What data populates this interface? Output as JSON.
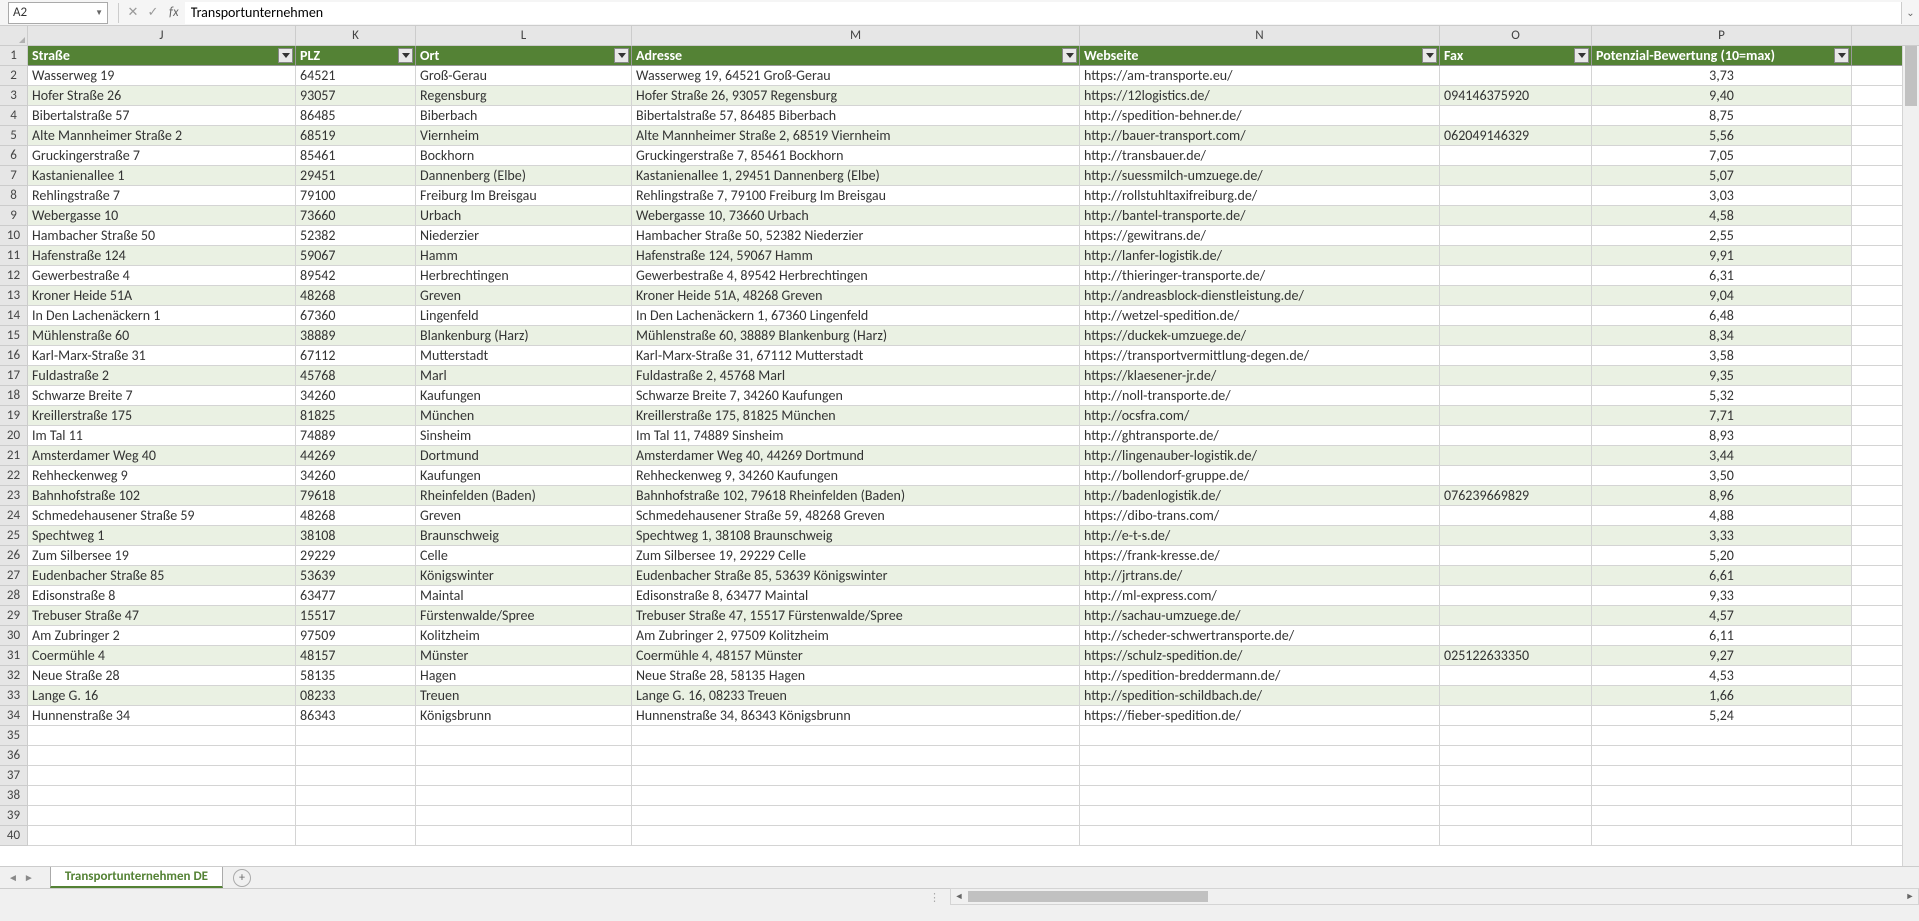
{
  "name_box": "A2",
  "formula_value": "Transportunternehmen",
  "sheet_tab": "Transportunternehmen DE",
  "columns_letters": [
    "J",
    "K",
    "L",
    "M",
    "N",
    "O",
    "P"
  ],
  "headers": {
    "J": "Straße",
    "K": "PLZ",
    "L": "Ort",
    "M": "Adresse",
    "N": "Webseite",
    "O": "Fax",
    "P": "Potenzial-Bewertung (10=max)"
  },
  "rows": [
    {
      "n": 2,
      "J": "Wasserweg 19",
      "K": "64521",
      "L": "Groß-Gerau",
      "M": "Wasserweg 19, 64521 Groß-Gerau",
      "N": "https://am-transporte.eu/",
      "O": "",
      "P": "3,73"
    },
    {
      "n": 3,
      "J": "Hofer Straße 26",
      "K": "93057",
      "L": "Regensburg",
      "M": "Hofer Straße 26, 93057 Regensburg",
      "N": "https://12logistics.de/",
      "O": "094146375920",
      "P": "9,40"
    },
    {
      "n": 4,
      "J": "Bibertalstraße 57",
      "K": "86485",
      "L": "Biberbach",
      "M": "Bibertalstraße 57, 86485 Biberbach",
      "N": "http://spedition-behner.de/",
      "O": "",
      "P": "8,75"
    },
    {
      "n": 5,
      "J": "Alte Mannheimer Straße 2",
      "K": "68519",
      "L": "Viernheim",
      "M": "Alte Mannheimer Straße 2, 68519 Viernheim",
      "N": "http://bauer-transport.com/",
      "O": "062049146329",
      "P": "5,56"
    },
    {
      "n": 6,
      "J": "Gruckingerstraße 7",
      "K": "85461",
      "L": "Bockhorn",
      "M": "Gruckingerstraße 7, 85461 Bockhorn",
      "N": "http://transbauer.de/",
      "O": "",
      "P": "7,05"
    },
    {
      "n": 7,
      "J": "Kastanienallee 1",
      "K": "29451",
      "L": "Dannenberg (Elbe)",
      "M": "Kastanienallee 1, 29451 Dannenberg (Elbe)",
      "N": "http://suessmilch-umzuege.de/",
      "O": "",
      "P": "5,07"
    },
    {
      "n": 8,
      "J": "Rehlingstraße 7",
      "K": "79100",
      "L": "Freiburg Im Breisgau",
      "M": "Rehlingstraße 7, 79100 Freiburg Im Breisgau",
      "N": "http://rollstuhltaxifreiburg.de/",
      "O": "",
      "P": "3,03"
    },
    {
      "n": 9,
      "J": "Webergasse 10",
      "K": "73660",
      "L": "Urbach",
      "M": "Webergasse 10, 73660 Urbach",
      "N": "http://bantel-transporte.de/",
      "O": "",
      "P": "4,58"
    },
    {
      "n": 10,
      "J": "Hambacher Straße 50",
      "K": "52382",
      "L": "Niederzier",
      "M": "Hambacher Straße 50, 52382 Niederzier",
      "N": "https://gewitrans.de/",
      "O": "",
      "P": "2,55"
    },
    {
      "n": 11,
      "J": "Hafenstraße 124",
      "K": "59067",
      "L": "Hamm",
      "M": "Hafenstraße 124, 59067 Hamm",
      "N": "http://lanfer-logistik.de/",
      "O": "",
      "P": "9,91"
    },
    {
      "n": 12,
      "J": "Gewerbestraße 4",
      "K": "89542",
      "L": "Herbrechtingen",
      "M": "Gewerbestraße 4, 89542 Herbrechtingen",
      "N": "http://thieringer-transporte.de/",
      "O": "",
      "P": "6,31"
    },
    {
      "n": 13,
      "J": "Kroner Heide 51A",
      "K": "48268",
      "L": "Greven",
      "M": "Kroner Heide 51A, 48268 Greven",
      "N": "http://andreasblock-dienstleistung.de/",
      "O": "",
      "P": "9,04"
    },
    {
      "n": 14,
      "J": "In Den Lachenäckern 1",
      "K": "67360",
      "L": "Lingenfeld",
      "M": "In Den Lachenäckern 1, 67360 Lingenfeld",
      "N": "http://wetzel-spedition.de/",
      "O": "",
      "P": "6,48"
    },
    {
      "n": 15,
      "J": "Mühlenstraße 60",
      "K": "38889",
      "L": "Blankenburg (Harz)",
      "M": "Mühlenstraße 60, 38889 Blankenburg (Harz)",
      "N": "https://duckek-umzuege.de/",
      "O": "",
      "P": "8,34"
    },
    {
      "n": 16,
      "J": "Karl-Marx-Straße 31",
      "K": "67112",
      "L": "Mutterstadt",
      "M": "Karl-Marx-Straße 31, 67112 Mutterstadt",
      "N": "https://transportvermittlung-degen.de/",
      "O": "",
      "P": "3,58"
    },
    {
      "n": 17,
      "J": "Fuldastraße 2",
      "K": "45768",
      "L": "Marl",
      "M": "Fuldastraße 2, 45768 Marl",
      "N": "https://klaesener-jr.de/",
      "O": "",
      "P": "9,35"
    },
    {
      "n": 18,
      "J": "Schwarze Breite 7",
      "K": "34260",
      "L": "Kaufungen",
      "M": "Schwarze Breite 7, 34260 Kaufungen",
      "N": "http://noll-transporte.de/",
      "O": "",
      "P": "5,32"
    },
    {
      "n": 19,
      "J": "Kreillerstraße 175",
      "K": "81825",
      "L": "München",
      "M": "Kreillerstraße 175, 81825 München",
      "N": "http://ocsfra.com/",
      "O": "",
      "P": "7,71"
    },
    {
      "n": 20,
      "J": "Im Tal 11",
      "K": "74889",
      "L": "Sinsheim",
      "M": "Im Tal 11, 74889 Sinsheim",
      "N": "http://ghtransporte.de/",
      "O": "",
      "P": "8,93"
    },
    {
      "n": 21,
      "J": "Amsterdamer Weg 40",
      "K": "44269",
      "L": "Dortmund",
      "M": "Amsterdamer Weg 40, 44269 Dortmund",
      "N": "http://lingenauber-logistik.de/",
      "O": "",
      "P": "3,44"
    },
    {
      "n": 22,
      "J": "Rehheckenweg 9",
      "K": "34260",
      "L": "Kaufungen",
      "M": "Rehheckenweg 9, 34260 Kaufungen",
      "N": "http://bollendorf-gruppe.de/",
      "O": "",
      "P": "3,50"
    },
    {
      "n": 23,
      "J": "Bahnhofstraße 102",
      "K": "79618",
      "L": "Rheinfelden (Baden)",
      "M": "Bahnhofstraße 102, 79618 Rheinfelden (Baden)",
      "N": "http://badenlogistik.de/",
      "O": "076239669829",
      "P": "8,96"
    },
    {
      "n": 24,
      "J": "Schmedehausener Straße 59",
      "K": "48268",
      "L": "Greven",
      "M": "Schmedehausener Straße 59, 48268 Greven",
      "N": "https://dibo-trans.com/",
      "O": "",
      "P": "4,88"
    },
    {
      "n": 25,
      "J": "Spechtweg 1",
      "K": "38108",
      "L": "Braunschweig",
      "M": "Spechtweg 1, 38108 Braunschweig",
      "N": "http://e-t-s.de/",
      "O": "",
      "P": "3,33"
    },
    {
      "n": 26,
      "J": "Zum Silbersee 19",
      "K": "29229",
      "L": "Celle",
      "M": "Zum Silbersee 19, 29229 Celle",
      "N": "https://frank-kresse.de/",
      "O": "",
      "P": "5,20"
    },
    {
      "n": 27,
      "J": "Eudenbacher Straße 85",
      "K": "53639",
      "L": "Königswinter",
      "M": "Eudenbacher Straße 85, 53639 Königswinter",
      "N": "http://jrtrans.de/",
      "O": "",
      "P": "6,61"
    },
    {
      "n": 28,
      "J": "Edisonstraße 8",
      "K": "63477",
      "L": "Maintal",
      "M": "Edisonstraße 8, 63477 Maintal",
      "N": "http://ml-express.com/",
      "O": "",
      "P": "9,33"
    },
    {
      "n": 29,
      "J": "Trebuser Straße 47",
      "K": "15517",
      "L": "Fürstenwalde/Spree",
      "M": "Trebuser Straße 47, 15517 Fürstenwalde/Spree",
      "N": "http://sachau-umzuege.de/",
      "O": "",
      "P": "4,57"
    },
    {
      "n": 30,
      "J": "Am Zubringer 2",
      "K": "97509",
      "L": "Kolitzheim",
      "M": "Am Zubringer 2, 97509 Kolitzheim",
      "N": "http://scheder-schwertransporte.de/",
      "O": "",
      "P": "6,11"
    },
    {
      "n": 31,
      "J": "Coermühle 4",
      "K": "48157",
      "L": "Münster",
      "M": "Coermühle 4, 48157 Münster",
      "N": "https://schulz-spedition.de/",
      "O": "025122633350",
      "P": "9,27"
    },
    {
      "n": 32,
      "J": "Neue Straße 28",
      "K": "58135",
      "L": "Hagen",
      "M": "Neue Straße 28, 58135 Hagen",
      "N": "http://spedition-breddermann.de/",
      "O": "",
      "P": "4,53"
    },
    {
      "n": 33,
      "J": "Lange G. 16",
      "K": "08233",
      "L": "Treuen",
      "M": "Lange G. 16, 08233 Treuen",
      "N": "http://spedition-schildbach.de/",
      "O": "",
      "P": "1,66"
    },
    {
      "n": 34,
      "J": "Hunnenstraße 34",
      "K": "86343",
      "L": "Königsbrunn",
      "M": "Hunnenstraße 34, 86343 Königsbrunn",
      "N": "https://fieber-spedition.de/",
      "O": "",
      "P": "5,24"
    }
  ]
}
